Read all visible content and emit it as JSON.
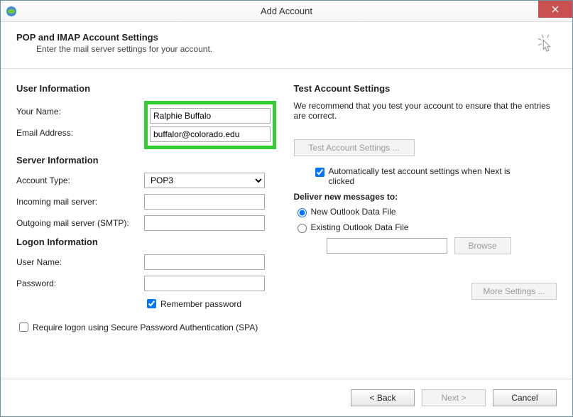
{
  "window": {
    "title": "Add Account"
  },
  "header": {
    "title": "POP and IMAP Account Settings",
    "subtitle": "Enter the mail server settings for your account."
  },
  "left": {
    "userInfoTitle": "User Information",
    "yourNameLabel": "Your Name:",
    "yourNameValue": "Ralphie Buffalo",
    "emailLabel": "Email Address:",
    "emailValue": "buffalor@colorado.edu",
    "serverInfoTitle": "Server Information",
    "accountTypeLabel": "Account Type:",
    "accountTypeValue": "POP3",
    "incomingLabel": "Incoming mail server:",
    "incomingValue": "",
    "outgoingLabel": "Outgoing mail server (SMTP):",
    "outgoingValue": "",
    "logonInfoTitle": "Logon Information",
    "userNameLabel": "User Name:",
    "userNameValue": "",
    "passwordLabel": "Password:",
    "passwordValue": "",
    "rememberLabel": "Remember password",
    "spaLabel": "Require logon using Secure Password Authentication (SPA)"
  },
  "right": {
    "testTitle": "Test Account Settings",
    "testDesc": "We recommend that you test your account to ensure that the entries are correct.",
    "testBtn": "Test Account Settings ...",
    "autoTestLabel": "Automatically test account settings when Next is clicked",
    "deliverTitle": "Deliver new messages to:",
    "newFileLabel": "New Outlook Data File",
    "existingFileLabel": "Existing Outlook Data File",
    "browseBtn": "Browse",
    "moreSettingsBtn": "More Settings ..."
  },
  "footer": {
    "back": "< Back",
    "next": "Next >",
    "cancel": "Cancel"
  }
}
